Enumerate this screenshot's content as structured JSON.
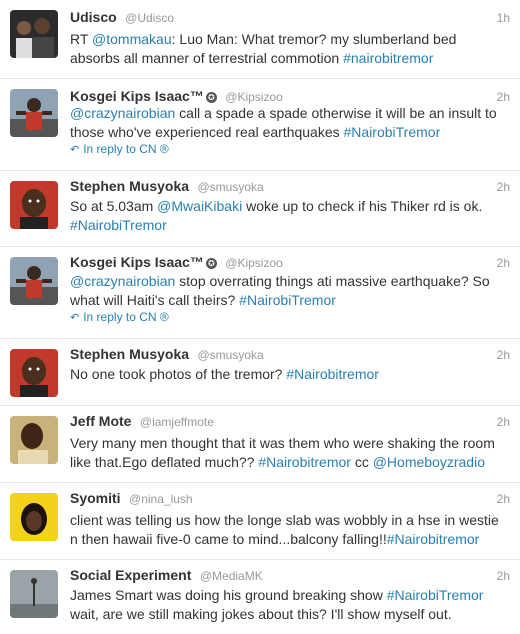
{
  "tweets": [
    {
      "name": "Udisco",
      "handle": "@Udisco",
      "time": "1h",
      "parts": [
        {
          "t": "RT ",
          "link": false
        },
        {
          "t": "@tommakau",
          "link": true
        },
        {
          "t": ": Luo Man: What tremor? my slumberland bed absorbs all manner of terrestrial commotion ",
          "link": false
        },
        {
          "t": "#nairobitremor",
          "link": true
        }
      ]
    },
    {
      "name": "Kosgei Kips Isaac™",
      "badge": "✪",
      "handle": "@Kipsizoo",
      "time": "2h",
      "parts": [
        {
          "t": "@crazynairobian",
          "link": true
        },
        {
          "t": " call a spade a spade otherwise it will be an insult to those who've experienced real earthquakes ",
          "link": false
        },
        {
          "t": "#NairobiTremor",
          "link": true
        }
      ],
      "reply": "In reply to CN ®"
    },
    {
      "name": "Stephen Musyoka",
      "handle": "@smusyoka",
      "time": "2h",
      "parts": [
        {
          "t": "So at 5.03am ",
          "link": false
        },
        {
          "t": "@MwaiKibaki",
          "link": true
        },
        {
          "t": " woke up to check if his Thiker rd is ok. ",
          "link": false
        },
        {
          "t": "#NairobiTremor",
          "link": true
        }
      ]
    },
    {
      "name": "Kosgei Kips Isaac™",
      "badge": "✪",
      "handle": "@Kipsizoo",
      "time": "2h",
      "parts": [
        {
          "t": "@crazynairobian",
          "link": true
        },
        {
          "t": " stop overrating things ati massive earthquake? So what will Haiti's call theirs? ",
          "link": false
        },
        {
          "t": "#NairobiTremor",
          "link": true
        }
      ],
      "reply": "In reply to CN ®"
    },
    {
      "name": "Stephen Musyoka",
      "handle": "@smusyoka",
      "time": "2h",
      "parts": [
        {
          "t": "No one took photos of the tremor? ",
          "link": false
        },
        {
          "t": "#Nairobitremor",
          "link": true
        }
      ]
    },
    {
      "name": "Jeff Mote",
      "handle": "@iamjeffmote",
      "time": "2h",
      "parts": [
        {
          "t": "Very many men thought that it was them who were shaking the room like that.Ego deflated much?? ",
          "link": false
        },
        {
          "t": "#Nairobitremor",
          "link": true
        },
        {
          "t": " cc ",
          "link": false
        },
        {
          "t": "@Homeboyzradio",
          "link": true
        }
      ]
    },
    {
      "name": "Syomiti",
      "handle": "@nina_lush",
      "time": "2h",
      "parts": [
        {
          "t": "client was telling us how the longe slab was wobbly in a hse in westie n then hawaii five-0 came to mind...balcony falling!!",
          "link": false
        },
        {
          "t": "#Nairobitremor",
          "link": true
        }
      ]
    },
    {
      "name": "Social Experiment",
      "handle": "@MediaMK",
      "time": "2h",
      "parts": [
        {
          "t": "James Smart was doing his ground breaking show ",
          "link": false
        },
        {
          "t": "#NairobiTremor",
          "link": true
        },
        {
          "t": " wait, are we still making jokes about this? I'll show myself out.",
          "link": false
        }
      ]
    }
  ],
  "colors": {
    "link": "#2a7fb0",
    "meta": "#999999",
    "text": "#333333",
    "divider": "#e8e8e8"
  },
  "icons": {
    "reply": "reply-arrow-icon",
    "badge": "verified-star-icon"
  }
}
